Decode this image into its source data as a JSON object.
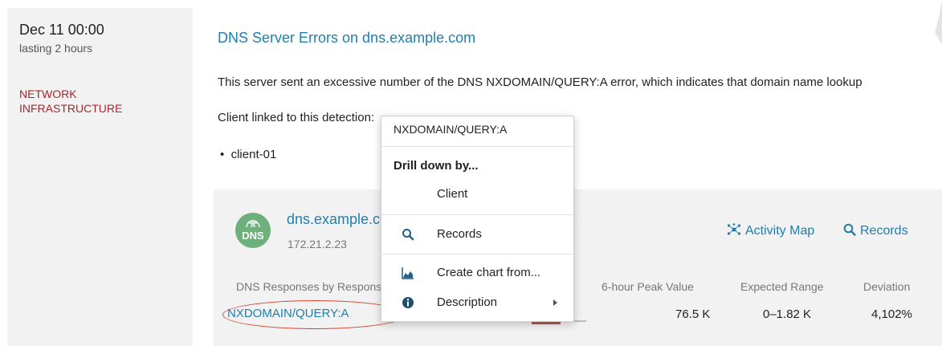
{
  "detection": {
    "time": "Dec 11 00:00",
    "duration": "lasting 2 hours",
    "category": "NETWORK INFRASTRUCTURE",
    "title": "DNS Server Errors on dns.example.com",
    "description": "This server sent an excessive number of the DNS NXDOMAIN/QUERY:A error, which indicates that domain name lookup",
    "linked_label": "Client linked to this detection:",
    "clients": [
      "client-01"
    ]
  },
  "device": {
    "icon_label": "DNS",
    "name": "dns.example.com",
    "ip": "172.21.2.23",
    "actions": {
      "activity_map": "Activity Map",
      "records": "Records"
    }
  },
  "table": {
    "headers": {
      "metric": "DNS Responses by Response",
      "peak": "6-hour Peak Value",
      "range": "Expected Range",
      "deviation": "Deviation"
    },
    "row": {
      "metric": "NXDOMAIN/QUERY:A",
      "peak": "76.5 K",
      "range": "0–1.82 K",
      "deviation": "4,102%"
    }
  },
  "context_menu": {
    "header": "NXDOMAIN/QUERY:A",
    "section": "Drill down by...",
    "items": [
      {
        "label": "Client",
        "icon": ""
      },
      {
        "label": "Records",
        "icon": "search-icon"
      },
      {
        "label": "Create chart from...",
        "icon": "area-chart-icon"
      },
      {
        "label": "Description",
        "icon": "info-icon"
      }
    ]
  },
  "colors": {
    "link": "#1f7fae",
    "category": "#a6262a",
    "dns_icon": "#6db07b",
    "highlight_circle": "#d9442f"
  }
}
